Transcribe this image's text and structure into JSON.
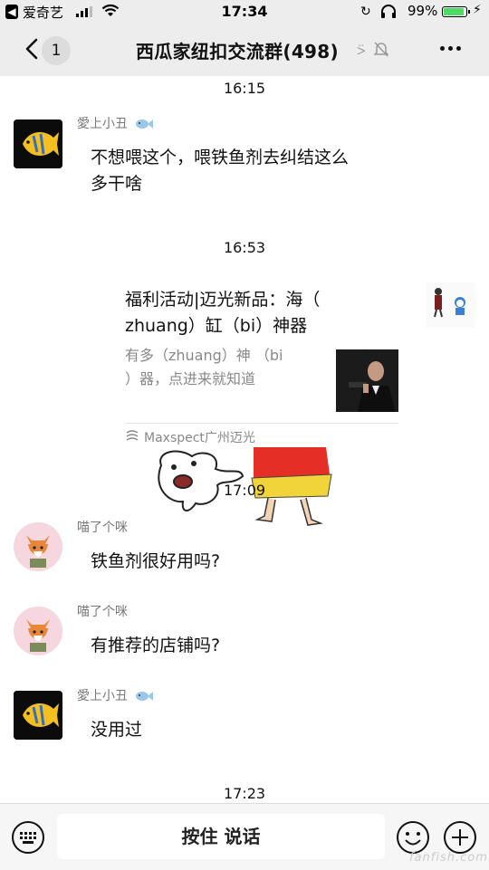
{
  "status_bar": {
    "back_app": "爱奇艺",
    "time": "17:34",
    "battery_percent": "99%",
    "battery_level": 0.99
  },
  "nav": {
    "back_badge": "1",
    "title": "西瓜家纽扣交流群(498)"
  },
  "messages": [
    {
      "type": "timestamp",
      "text": "16:15"
    },
    {
      "type": "text",
      "sender": "愛上小丑",
      "text_lines": [
        "不想喂这个，喂铁鱼剂去纠结这么",
        "多干啥"
      ]
    },
    {
      "type": "timestamp",
      "text": "16:53"
    },
    {
      "type": "card",
      "title_lines": [
        "福利活动|迈光新品：海（",
        "zhuang）缸（bi）神器"
      ],
      "desc_lines": [
        "有多（zhuang）神 （bi",
        "）器，点进来就知道"
      ],
      "source": "Maxspect广州迈光"
    },
    {
      "type": "timestamp",
      "text": "17:09"
    },
    {
      "type": "text",
      "sender": "喵了个咪",
      "text": "铁鱼剂很好用吗?"
    },
    {
      "type": "text",
      "sender": "喵了个咪",
      "text": "有推荐的店铺吗?"
    },
    {
      "type": "text",
      "sender": "愛上小丑",
      "text": "没用过"
    },
    {
      "type": "timestamp",
      "text": "17:23"
    }
  ],
  "input_bar": {
    "hold_to_talk": "按住 说话"
  },
  "watermark": "fanfish.com",
  "colors": {
    "nav_bg": "#ededed",
    "chat_bg": "#ffffff",
    "battery": "#4cd964"
  }
}
